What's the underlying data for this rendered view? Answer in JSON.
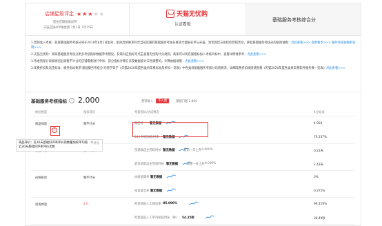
{
  "header": {
    "rating_label": "店铺星级评定",
    "stars_on": 3,
    "stars_total": 5,
    "sub1": "前往店铺星级说明",
    "sub2": "天猫店铺APP端星级 7月1日-7月15日",
    "brand": "天猫无忧购",
    "brand_sub": "认证看板",
    "active_tab": "基础服务考核综合分"
  },
  "notes": [
    {
      "text": "1.营销准入考核：获取基础服务考核分将于2019年8月1日生效，生效后将要求符合当前店铺的基础服务考核分要求才能报名参与天猫、淘宝网官方组织的营销活动，获取基础服务考核分的规则请看：",
      "links": [
        "点此查看>>>",
        "变更要点>>>",
        "点此查看>>>",
        "服务考核准确率说明>>>"
      ],
      "tail": "立即 >>> 。"
    },
    {
      "text": "2.天猫无忧购：商家基础服务考核分更多考核指标数据参考建议，获取对应指标可点击查看无忧购计分规则，商家可以将店铺指标加入考核目标中，查看详情请参考：",
      "links": [
        "点此查看>>>"
      ],
      "tail": ""
    },
    {
      "text": "3.考虑到部分商家原因出现暂不计分的店铺需要进行申诉，部分指标计算方法及数据统计口径调整的。计算依据请看：",
      "links": [
        "点此查看>>>"
      ],
      "tail": ""
    },
    {
      "text": "3.年费折扣及返还标准：服务指标要求'基础服务考核分'均值于等于《天猫2020年度各类目年费标准及折扣一览表》中各类目基础服务考核分均值要求，详细年费折扣规则请查看《天猫2020年度各类目年费软件服务费一览表》",
      "links": [
        "点此查看>>>"
      ],
      "tail": ""
    }
  ],
  "score": {
    "label": "基础服务考核指标",
    "value": "2.000",
    "entry_label": "营销准入",
    "pill": "不入围",
    "threshold": "基础门槛 2.800"
  },
  "table": {
    "headers": [
      "体验维度",
      "指标得分",
      "考核指标/达成情况",
      "4分标准"
    ],
    "rows": [
      {
        "dim": "商品体验",
        "score": "暂不计分",
        "metric": "商品分",
        "value": "暂无数据",
        "std": "4.903"
      },
      {
        "dim": "",
        "score": "",
        "metric": "24小时揽收及时率",
        "value": "暂无数据",
        "std": "79.237%"
      },
      {
        "dim": "售后体验",
        "score": "暂不计分",
        "metric": "仅退款自主完结时长",
        "value": "暂无数据",
        "std": "0.21天"
      },
      {
        "dim": "",
        "score": "",
        "metric": "退货退款自主完结时长",
        "value": "暂无数据",
        "std": "2.43天"
      },
      {
        "dim": "纠纷投诉",
        "score": "暂不计分",
        "metric": "纠纷退款率",
        "value": "暂无数据",
        "std": "0%"
      },
      {
        "dim": "",
        "score": "",
        "metric": "投诉成立率",
        "value": "暂无数据",
        "std": "0.275%"
      },
      {
        "dim": "咨询体验",
        "score": "2.0",
        "metric": "阿里旺旺人工响应率",
        "value": "85.000%",
        "std": "99.219%"
      },
      {
        "dim": "",
        "score": "",
        "metric": "阿里旺旺人工平均响应时长（秒）",
        "value": "54.25秒",
        "std": "38.49秒"
      }
    ],
    "change_prefix": "较前一天上升",
    "change_value": "0.000%",
    "tooltip": [
      "商品评价：近30天基础好评率评价的数量加权平均值",
      "近30天基础好评率评价次数"
    ],
    "tooltip_right": "不计分"
  },
  "colors": {
    "accent": "#e4393c",
    "link": "#1e88e5"
  }
}
